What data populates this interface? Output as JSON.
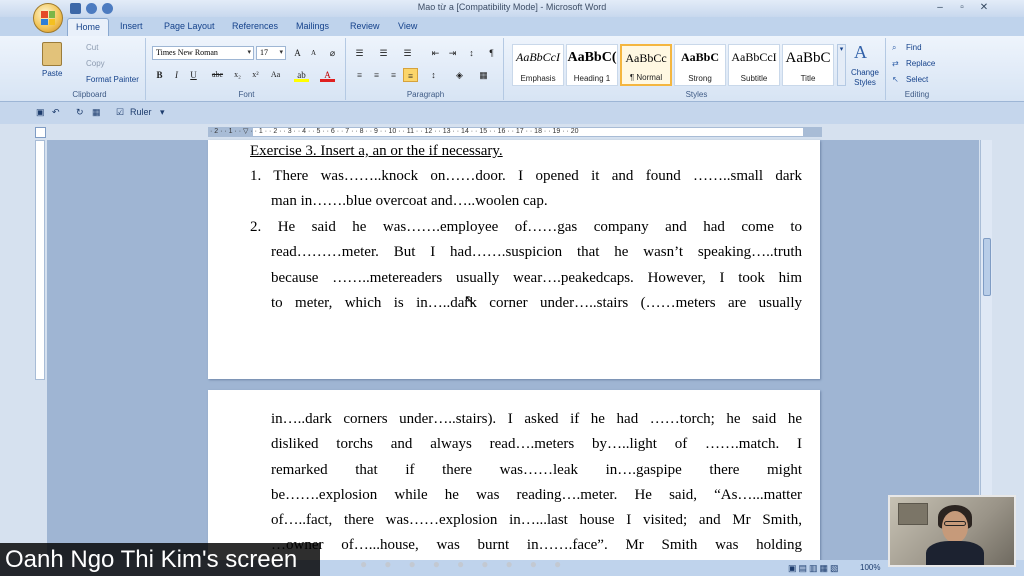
{
  "window": {
    "title": "Mao từ a [Compatibility Mode] - Microsoft Word"
  },
  "tabs": [
    "Home",
    "Insert",
    "Page Layout",
    "References",
    "Mailings",
    "Review",
    "View"
  ],
  "clipboard": {
    "paste": "Paste",
    "cut": "Cut",
    "copy": "Copy",
    "format_painter": "Format Painter",
    "label": "Clipboard"
  },
  "font": {
    "name": "Times New Roman",
    "size": "17",
    "label": "Font"
  },
  "paragraph": {
    "label": "Paragraph"
  },
  "styles": {
    "items": [
      {
        "sample": "AaBbCcI",
        "name": "Emphasis"
      },
      {
        "sample": "AaBbC(",
        "name": "Heading 1"
      },
      {
        "sample": "AaBbCc",
        "name": "¶ Normal"
      },
      {
        "sample": "AaBbC",
        "name": "Strong"
      },
      {
        "sample": "AaBbCcI",
        "name": "Subtitle"
      },
      {
        "sample": "AaBbC",
        "name": "Title"
      }
    ],
    "change_styles": "Change Styles",
    "label": "Styles"
  },
  "editing": {
    "find": "Find",
    "replace": "Replace",
    "select": "Select",
    "label": "Editing"
  },
  "qat": {
    "ruler": "Ruler"
  },
  "document": {
    "heading": "Exercise 3. Insert a, an or the if necessary.",
    "item1_lines": [
      "1. There was……..knock on……door. I opened it and found ……..small dark",
      "man in…….blue overcoat and…..woolen cap."
    ],
    "item2_lines": [
      "2. He said he was…….employee of……gas company and had come to",
      "read………meter. But I had…….suspicion that he wasn’t speaking…..truth",
      "because ……..metereaders usually wear….peakedcaps. However, I took him",
      "to meter, which is in…..dark corner under…..stairs (……meters are usually"
    ],
    "page2_lines": [
      "in…..dark corners under…..stairs). I asked if he had ……torch; he said he",
      "disliked torchs and always read….meters by…..light of …….match. I",
      "remarked that if there was……leak in….gaspipe there might",
      "be…….explosion while he was reading….meter. He said, “As…...matter",
      "of…..fact, there was……explosion in…...last house I visited; and Mr Smith,",
      "…owner of…...house, was burnt in…….face”. Mr Smith was holding"
    ]
  },
  "status": {
    "zoom": "100%"
  },
  "overlay": {
    "screen_label": "Oanh Ngo Thi Kim's screen"
  }
}
